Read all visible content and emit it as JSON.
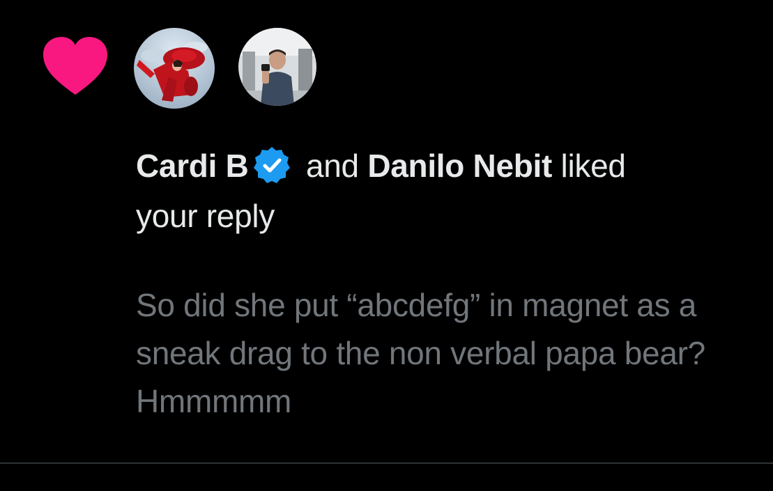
{
  "notification": {
    "type_icon": "heart-icon",
    "liker_1": {
      "name": "Cardi B",
      "verified": true,
      "avatar": "avatar-cardi-b"
    },
    "connector": "and",
    "liker_2": {
      "name": "Danilo Nebit",
      "avatar": "avatar-danilo-nebit"
    },
    "action": "liked",
    "action_rest": "your reply",
    "reply_text": "So did she put “abcdefg” in magnet as a sneak drag to the non verbal papa bear? Hmmmmm"
  },
  "colors": {
    "background": "#000000",
    "heart": "#f91880",
    "verified_badge": "#1d9bf0",
    "primary_text": "#e7e9ea",
    "secondary_text": "#71767b",
    "divider": "#2f3336"
  }
}
